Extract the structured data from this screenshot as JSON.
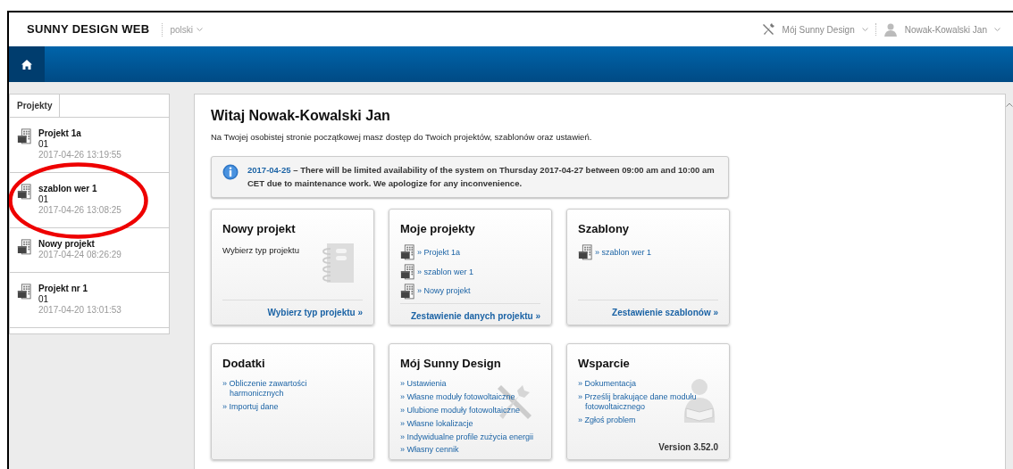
{
  "header": {
    "logo": "SUNNY DESIGN WEB",
    "language": "polski",
    "menus": [
      {
        "label": "Mój Sunny Design"
      },
      {
        "label": "Nowak-Kowalski Jan"
      }
    ]
  },
  "sidebar": {
    "tabs": [
      {
        "label": "Projekty",
        "selected": true
      }
    ],
    "items": [
      {
        "name": "Projekt 1a",
        "code": "01",
        "date": "2017-04-26 13:19:55"
      },
      {
        "name": "szablon wer 1",
        "code": "01",
        "date": "2017-04-26 13:08:25"
      },
      {
        "name": "Nowy projekt",
        "date": "2017-04-24 08:26:29"
      },
      {
        "name": "Projekt nr 1",
        "code": "01",
        "date": "2017-04-20 13:01:53"
      }
    ]
  },
  "annotation": {
    "kind": "ellipse"
  },
  "main": {
    "title": "Witaj Nowak-Kowalski Jan",
    "intro": "Na Twojej osobistej stronie początkowej masz dostęp do Twoich projektów, szablonów oraz ustawień.",
    "notice": {
      "date": "2017-04-25",
      "text": " – There will be limited availability of the system on Thursday 2017-04-27 between 09:00 am and 10:00 am CET due to maintenance work. We apologize for any inconvenience."
    },
    "cards": [
      {
        "title": "Nowy projekt",
        "kind": "text",
        "text": "Wybierz typ projektu",
        "footer": "Wybierz typ projektu »"
      },
      {
        "title": "Moje projekty",
        "kind": "projects",
        "links": [
          "» Projekt 1a",
          "» szablon wer 1",
          "» Nowy projekt"
        ],
        "footer": "Zestawienie danych projektu »"
      },
      {
        "title": "Szablony",
        "kind": "projects",
        "links": [
          "» szablon wer 1"
        ],
        "footer": "Zestawienie szablonów »"
      },
      {
        "title": "Dodatki",
        "kind": "links",
        "links": [
          "» Obliczenie zawartości harmonicznych",
          "» Importuj dane"
        ]
      },
      {
        "title": "Mój Sunny Design",
        "kind": "links",
        "links": [
          "» Ustawienia",
          "» Własne moduły fotowoltaiczne",
          "» Ulubione moduły fotowoltaiczne",
          "» Własne lokalizacje",
          "» Indywidualne profile zużycia energii",
          "» Własny cennik"
        ]
      },
      {
        "title": "Wsparcie",
        "kind": "links",
        "links": [
          "» Dokumentacja",
          "» Prześlij brakujące dane modułu fotowoltaicznego",
          "» Zgłoś problem"
        ],
        "version": "Version 3.52.0"
      }
    ]
  }
}
